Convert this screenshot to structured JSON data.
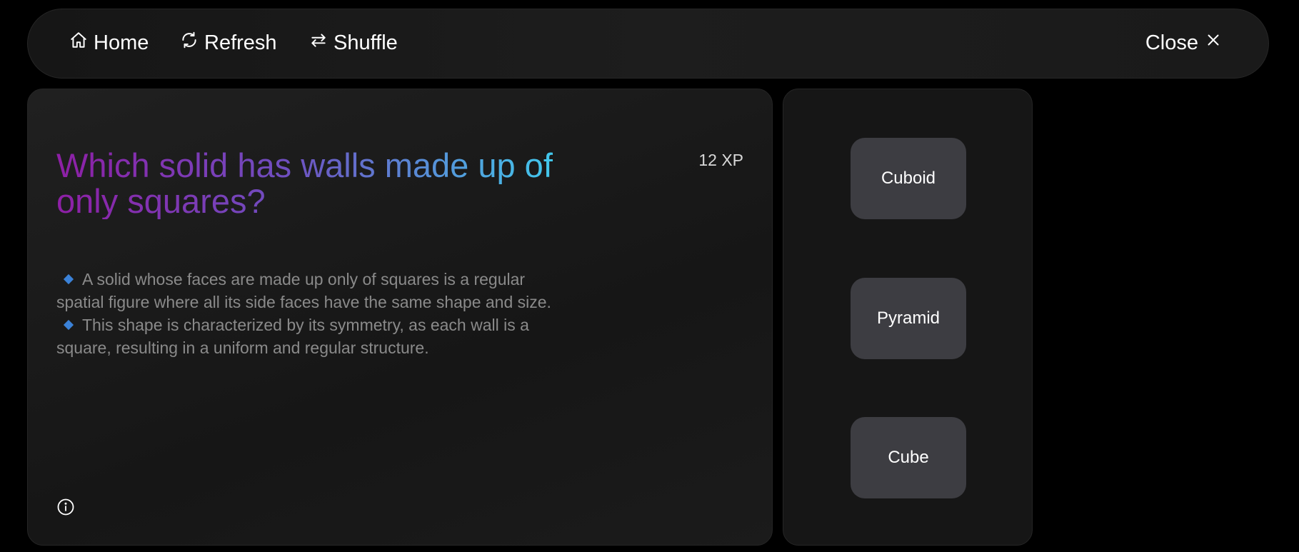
{
  "topbar": {
    "home_label": "Home",
    "refresh_label": "Refresh",
    "shuffle_label": "Shuffle",
    "close_label": "Close"
  },
  "question": {
    "text": "Which solid has walls made up of only squares?",
    "xp": "12 XP",
    "explanation": [
      "A solid whose faces are made up only of squares is a regular spatial figure where all its side faces have the same shape and size.",
      "This shape is characterized by its symmetry, as each wall is a square, resulting in a uniform and regular structure."
    ]
  },
  "options": [
    "Cuboid",
    "Pyramid",
    "Cube"
  ],
  "icons": {
    "home": "home-icon",
    "refresh": "refresh-icon",
    "shuffle": "shuffle-icon",
    "close": "close-icon",
    "info": "info-icon",
    "bullet": "diamond-bullet-icon"
  },
  "colors": {
    "question_gradient": [
      "#8e1fa6",
      "#6f4fc0",
      "#3fd0ef"
    ],
    "bullet": "#3b82d8",
    "option_bg": "#3d3d42"
  }
}
